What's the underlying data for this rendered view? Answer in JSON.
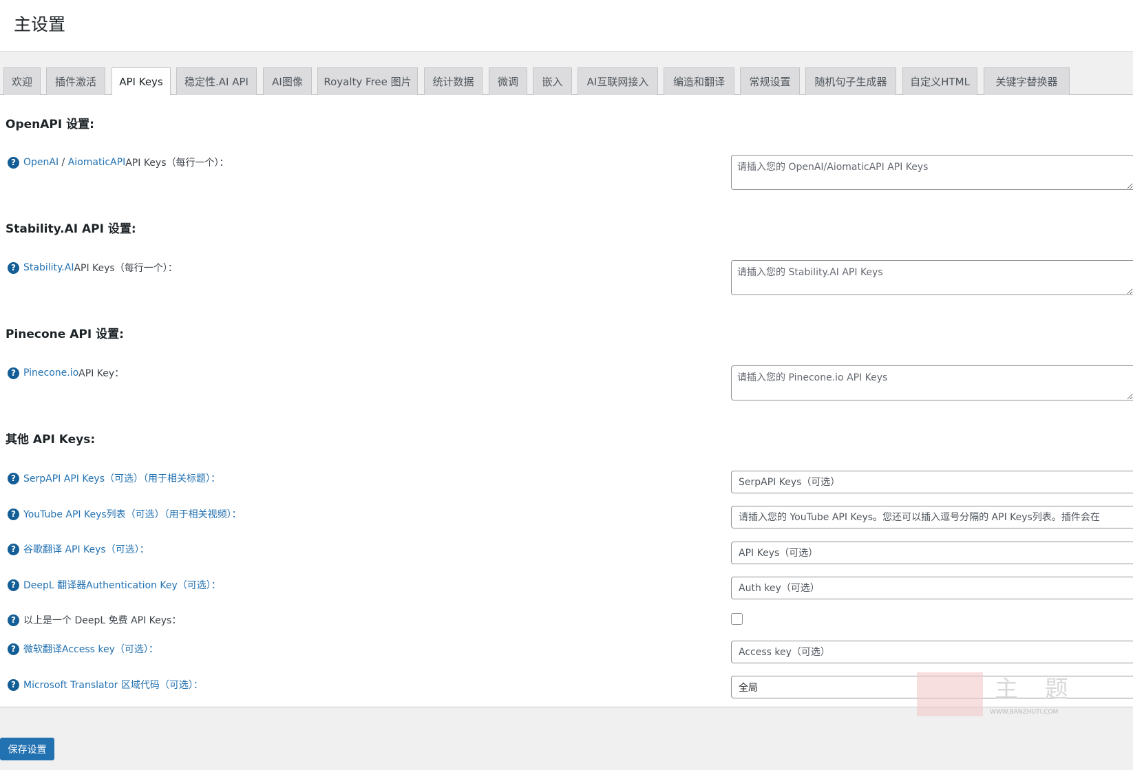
{
  "header": {
    "title": "主设置"
  },
  "tabs": [
    {
      "label": "欢迎"
    },
    {
      "label": "插件激活"
    },
    {
      "label": "API Keys"
    },
    {
      "label": "稳定性.AI API"
    },
    {
      "label": "AI图像"
    },
    {
      "label": "Royalty Free 图片"
    },
    {
      "label": "统计数据"
    },
    {
      "label": "微调"
    },
    {
      "label": "嵌入"
    },
    {
      "label": "AI互联网接入"
    },
    {
      "label": "编造和翻译"
    },
    {
      "label": "常规设置"
    },
    {
      "label": "随机句子生成器"
    },
    {
      "label": "自定义HTML"
    },
    {
      "label": "关键字替换器"
    }
  ],
  "active_tab": "API Keys",
  "sections": {
    "openapi": {
      "title": "OpenAPI 设置:",
      "label_link1": "OpenAI",
      "label_sep": " / ",
      "label_link2": "AiomaticAPI",
      "label_rest": " API Keys（每行一个）：",
      "placeholder": "请插入您的 OpenAI/AiomaticAPI API Keys"
    },
    "stability": {
      "title": "Stability.AI API 设置:",
      "label_link": "Stability.AI",
      "label_rest": " API Keys（每行一个）：",
      "placeholder": "请插入您的 Stability.AI API Keys"
    },
    "pinecone": {
      "title": "Pinecone API 设置:",
      "label_link": "Pinecone.io",
      "label_rest": " API Key：",
      "placeholder": "请插入您的 Pinecone.io API Keys"
    },
    "other": {
      "title": "其他 API Keys:",
      "serpapi": {
        "label": "SerpAPI API Keys（可选）（用于相关标题）：",
        "placeholder": "SerpAPI Keys（可选）"
      },
      "youtube": {
        "label": "YouTube API Keys列表（可选）（用于相关视频）：",
        "placeholder": "请插入您的 YouTube API Keys。您还可以插入逗号分隔的 API Keys列表。插件会在"
      },
      "google": {
        "label": "谷歌翻译 API Keys（可选）：",
        "placeholder": "API Keys（可选）"
      },
      "deepl": {
        "label": "DeepL 翻译器Authentication Key（可选）：",
        "placeholder": "Auth key（可选）"
      },
      "deepl_free": {
        "label": "以上是一个 DeepL 免费 API Keys："
      },
      "microsoft": {
        "label": "微软翻译Access key（可选）：",
        "placeholder": "Access key（可选）"
      },
      "region": {
        "label": "Microsoft Translator 区域代码（可选）：",
        "value": "全局"
      }
    }
  },
  "save_button": "保存设置",
  "watermark": {
    "site": "WWW.BANZHUTI.COM",
    "text": "主 题"
  },
  "colors": {
    "accent": "#2271b1",
    "link": "#2271b1",
    "background": "#f0f0f1"
  },
  "icons": {
    "help": "question-circle-icon",
    "help_glyph": "?"
  }
}
